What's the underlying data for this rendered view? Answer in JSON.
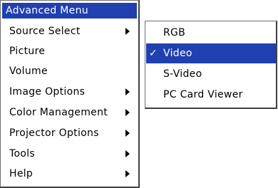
{
  "menu": {
    "title": "Advanced Menu",
    "items": [
      {
        "label": "Source Select",
        "has_submenu": true
      },
      {
        "label": "Picture",
        "has_submenu": false
      },
      {
        "label": "Volume",
        "has_submenu": false
      },
      {
        "label": "Image Options",
        "has_submenu": true
      },
      {
        "label": "Color Management",
        "has_submenu": true
      },
      {
        "label": "Projector Options",
        "has_submenu": true
      },
      {
        "label": "Tools",
        "has_submenu": true
      },
      {
        "label": "Help",
        "has_submenu": true
      }
    ]
  },
  "submenu": {
    "items": [
      {
        "label": "RGB",
        "checked": false
      },
      {
        "label": "Video",
        "checked": true
      },
      {
        "label": "S-Video",
        "checked": false
      },
      {
        "label": "PC Card Viewer",
        "checked": false
      }
    ],
    "check_glyph": "✓"
  },
  "colors": {
    "highlight": "#2040b0",
    "text": "#000000",
    "background": "#ffffff"
  }
}
